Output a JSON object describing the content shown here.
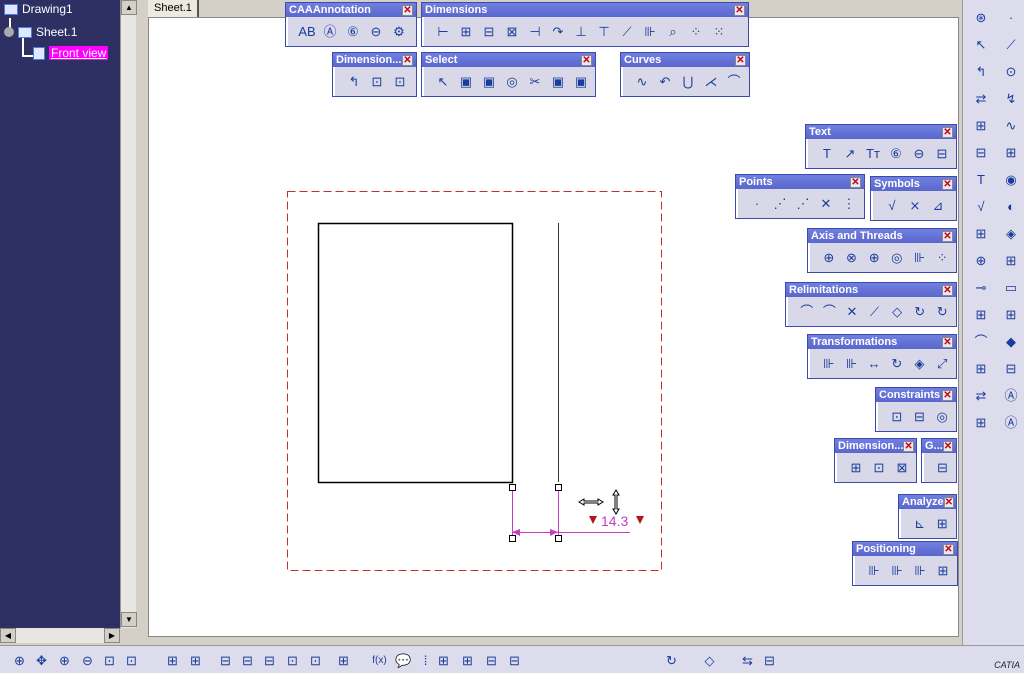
{
  "tree": {
    "root": "Drawing1",
    "sheet": "Sheet.1",
    "view": "Front view"
  },
  "tab": {
    "label": "Sheet.1"
  },
  "drawing": {
    "dimension_value": "14.3",
    "dimension_color": "#c040c0",
    "frame_color": "#c03030"
  },
  "toolbars": [
    {
      "title": "CAAAnnotation",
      "icons": [
        "AB",
        "Ⓐ",
        "⑥",
        "⊖",
        "⚙"
      ]
    },
    {
      "title": "Dimensions",
      "icons": [
        "⊢",
        "⊞",
        "⊟",
        "⊠",
        "⊣",
        "↷",
        "⊥",
        "⊤",
        "⟋",
        "⊪",
        "⌕",
        "⁘",
        "⁙"
      ]
    },
    {
      "title": "Dimension...",
      "icons": [
        "↰",
        "⊡",
        "⊡"
      ]
    },
    {
      "title": "Select",
      "icons": [
        "↖",
        "▣",
        "▣",
        "◎",
        "✂",
        "▣",
        "▣"
      ]
    },
    {
      "title": "Curves",
      "icons": [
        "∿",
        "↶",
        "⋃",
        "⋌",
        "⌒"
      ]
    },
    {
      "title": "Text",
      "icons": [
        "T",
        "↗",
        "Tт",
        "⑥",
        "⊖",
        "⊟"
      ]
    },
    {
      "title": "Points",
      "icons": [
        "·",
        "⋰",
        "⋰",
        "✕",
        "⋮"
      ]
    },
    {
      "title": "Symbols",
      "icons": [
        "√",
        "⨯",
        "⊿"
      ]
    },
    {
      "title": "Axis and Threads",
      "icons": [
        "⊕",
        "⊗",
        "⊕",
        "◎",
        "⊪",
        "⁘"
      ]
    },
    {
      "title": "Relimitations",
      "icons": [
        "⌒",
        "⌒",
        "✕",
        "⟋",
        "◇",
        "↻",
        "↻"
      ]
    },
    {
      "title": "Transformations",
      "icons": [
        "⊪",
        "⊪",
        "↔",
        "↻",
        "◈",
        "⤢"
      ]
    },
    {
      "title": "Constraints",
      "icons": [
        "⊡",
        "⊟",
        "◎"
      ]
    },
    {
      "title": "Dimension...",
      "icons": [
        "⊞",
        "⊡",
        "⊠"
      ]
    },
    {
      "title": "G...",
      "icons": [
        "⊟"
      ]
    },
    {
      "title": "Analyze",
      "icons": [
        "⊾",
        "⊞"
      ]
    },
    {
      "title": "Positioning",
      "icons": [
        "⊪",
        "⊪",
        "⊪",
        "⊞"
      ]
    }
  ],
  "right_toolbar": [
    "⊛",
    "·",
    "↖",
    "⟋",
    "↰",
    "⊙",
    "⇄",
    "↯",
    "⊞",
    "∿",
    "⊟",
    "⊞",
    "T",
    "◉",
    "√",
    "◐",
    "⊞",
    "◈",
    "⊕",
    "⊞",
    "⊸",
    "▭",
    "⊞",
    "⊞",
    "⌒",
    "◆",
    "⊞",
    "⊟",
    "⇄",
    "Ⓐ",
    "⊞",
    "Ⓐ"
  ],
  "bottom_toolbar": [
    "⊕",
    "✥",
    "⊕",
    "⊖",
    "⊡",
    "⊡",
    "⊞",
    "⊞",
    "⊟",
    "⊟",
    "⊟",
    "⊡",
    "⊡",
    "⊞",
    "f(x)",
    "💬",
    "⁞",
    "⊞",
    "⊞",
    "⊟",
    "⊟",
    "↻",
    "◇",
    "⇆",
    "⊟"
  ]
}
